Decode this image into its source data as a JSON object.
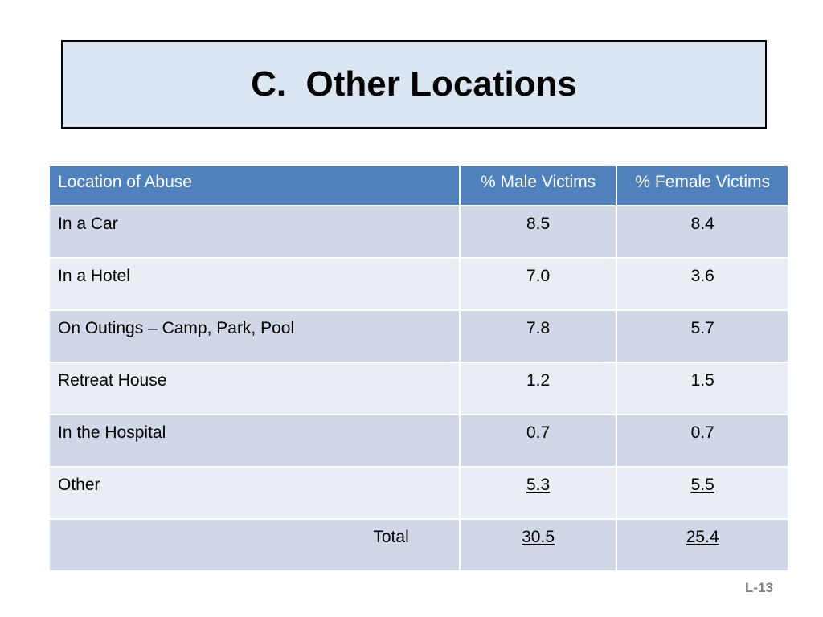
{
  "title": "C.  Other Locations",
  "table": {
    "headers": [
      "Location of Abuse",
      "% Male Victims",
      "% Female Victims"
    ],
    "rows": [
      {
        "location": "In a Car",
        "male": "8.5",
        "female": "8.4"
      },
      {
        "location": "In a Hotel",
        "male": "7.0",
        "female": "3.6"
      },
      {
        "location": "On Outings – Camp, Park, Pool",
        "male": "7.8",
        "female": "5.7"
      },
      {
        "location": "Retreat House",
        "male": "1.2",
        "female": "1.5"
      },
      {
        "location": "In the Hospital",
        "male": "0.7",
        "female": "0.7"
      },
      {
        "location": "Other",
        "male": "5.3",
        "female": "5.5"
      }
    ],
    "total": {
      "label": "Total",
      "male": "30.5",
      "female": "25.4"
    }
  },
  "slide_id": "L-13",
  "colors": {
    "title_bg": "#dce6f2",
    "header_bg": "#4f81bd",
    "row_dark": "#d0d8e8",
    "row_light": "#e9edf4",
    "slide_id": "#7f7f7f"
  }
}
